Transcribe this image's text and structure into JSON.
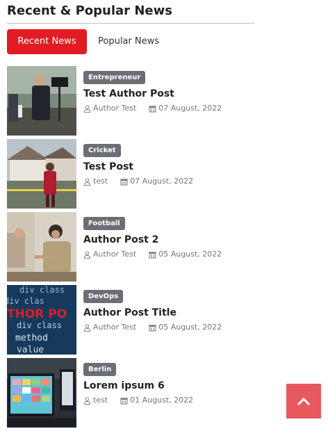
{
  "widget": {
    "title": "Recent & Popular News"
  },
  "tabs": [
    {
      "label": "Recent News",
      "active": true
    },
    {
      "label": "Popular News",
      "active": false
    }
  ],
  "posts": [
    {
      "category": "Entrepreneur",
      "title": "Test Author Post",
      "author": "Author Test",
      "date": "07 August, 2022"
    },
    {
      "category": "Cricket",
      "title": "Test Post",
      "author": "test",
      "date": "07 August, 2022"
    },
    {
      "category": "Football",
      "title": "Author Post 2",
      "author": "Author Test",
      "date": "05 August, 2022"
    },
    {
      "category": "DevOps",
      "title": "Author Post Title",
      "author": "Author Test",
      "date": "05 August, 2022"
    },
    {
      "category": "Berlin",
      "title": "Lorem ipsum 6",
      "author": "test",
      "date": "01 August, 2022"
    }
  ],
  "thumb4_overlay": {
    "code_words": [
      "div class",
      "div clas",
      "THOR PO",
      "div class",
      "method",
      "value"
    ]
  },
  "icons": {
    "author": "user-icon",
    "date": "calendar-icon",
    "back_to_top": "chevron-up-icon"
  },
  "colors": {
    "accent": "#e31b23",
    "badge": "#6b6e74",
    "back_to_top": "#e8585f",
    "meta_text": "#777777"
  }
}
